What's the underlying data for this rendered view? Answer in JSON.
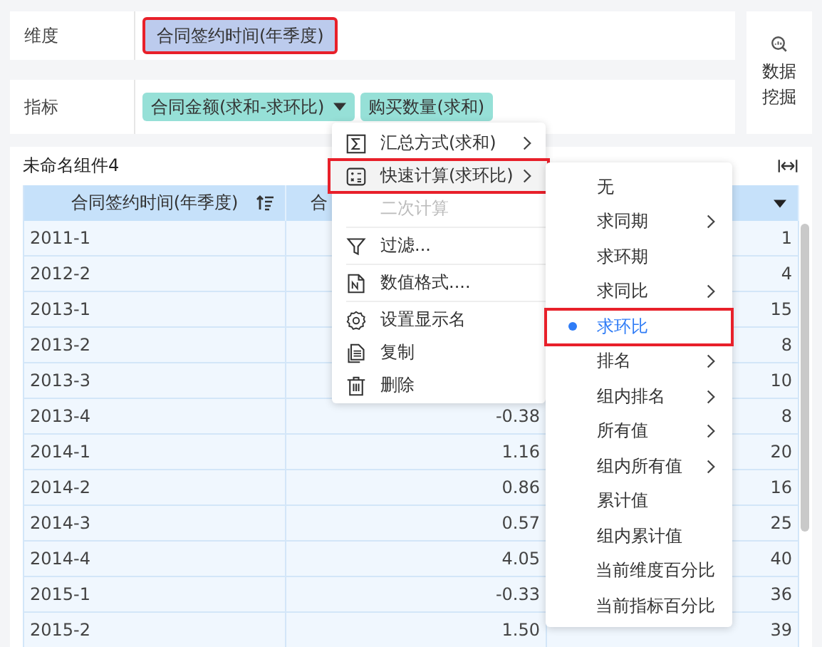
{
  "dimension": {
    "label": "维度",
    "chips": [
      {
        "text": "合同签约时间(年季度)",
        "highlighted": true
      }
    ]
  },
  "measure": {
    "label": "指标",
    "chips": [
      {
        "text": "合同金额(求和-求环比)",
        "dropdown": true
      },
      {
        "text": "购买数量(求和)",
        "dropdown": false
      }
    ]
  },
  "mining_button": {
    "label": "数据挖掘"
  },
  "component": {
    "title": "未命名组件4",
    "table": {
      "columns": [
        {
          "header": "合同签约时间(年季度)"
        },
        {
          "header": "合"
        },
        {}
      ],
      "rows": [
        {
          "time": "2011-1",
          "column_3": "1"
        },
        {
          "time": "2012-2",
          "column_3": "4"
        },
        {
          "time": "2013-1",
          "column_3": "15"
        },
        {
          "time": "2013-2",
          "column_3": "8"
        },
        {
          "time": "2013-3",
          "column_3": "10"
        },
        {
          "time": "2013-4",
          "column_2": "-0.38",
          "column_3": "8"
        },
        {
          "time": "2014-1",
          "column_2": "1.16",
          "column_3": "20"
        },
        {
          "time": "2014-2",
          "column_2": "0.86",
          "column_3": "16"
        },
        {
          "time": "2014-3",
          "column_2": "0.57",
          "column_3": "25"
        },
        {
          "time": "2014-4",
          "column_2": "4.05",
          "column_3": "40"
        },
        {
          "time": "2015-1",
          "column_2": "-0.33",
          "column_3": "36"
        },
        {
          "time": "2015-2",
          "column_2": "1.50",
          "column_3": "39"
        }
      ]
    }
  },
  "context_menu": {
    "items": [
      {
        "kind": "item",
        "text": "汇总方式(求和)",
        "submenu": true,
        "highlighted": false,
        "disabled": false
      },
      {
        "kind": "item",
        "text": "快速计算(求环比)",
        "submenu": true,
        "highlighted": true,
        "disabled": false
      },
      {
        "kind": "item",
        "text": "二次计算",
        "submenu": false,
        "highlighted": false,
        "disabled": true
      },
      {
        "kind": "divider"
      },
      {
        "kind": "item",
        "text": "过滤...",
        "submenu": false,
        "highlighted": false,
        "disabled": false
      },
      {
        "kind": "divider"
      },
      {
        "kind": "item",
        "text": "数值格式....",
        "submenu": false,
        "highlighted": false,
        "disabled": false
      },
      {
        "kind": "divider"
      },
      {
        "kind": "item",
        "text": "设置显示名",
        "submenu": false,
        "highlighted": false,
        "disabled": false
      },
      {
        "kind": "item",
        "text": "复制",
        "submenu": false,
        "highlighted": false,
        "disabled": false
      },
      {
        "kind": "item",
        "text": "删除",
        "submenu": false,
        "highlighted": false,
        "disabled": false
      }
    ]
  },
  "submenu": {
    "items": [
      {
        "text": "无",
        "submenu": false,
        "selected": false
      },
      {
        "text": "求同期",
        "submenu": true,
        "selected": false
      },
      {
        "text": "求环期",
        "submenu": false,
        "selected": false
      },
      {
        "text": "求同比",
        "submenu": true,
        "selected": false
      },
      {
        "text": "求环比",
        "submenu": false,
        "selected": true
      },
      {
        "text": "排名",
        "submenu": true,
        "selected": false
      },
      {
        "text": "组内排名",
        "submenu": true,
        "selected": false
      },
      {
        "text": "所有值",
        "submenu": true,
        "selected": false
      },
      {
        "text": "组内所有值",
        "submenu": true,
        "selected": false
      },
      {
        "text": "累计值",
        "submenu": false,
        "selected": false
      },
      {
        "text": "组内累计值",
        "submenu": false,
        "selected": false
      },
      {
        "text": "当前维度百分比",
        "submenu": false,
        "selected": false
      },
      {
        "text": "当前指标百分比",
        "submenu": false,
        "selected": false
      }
    ]
  }
}
